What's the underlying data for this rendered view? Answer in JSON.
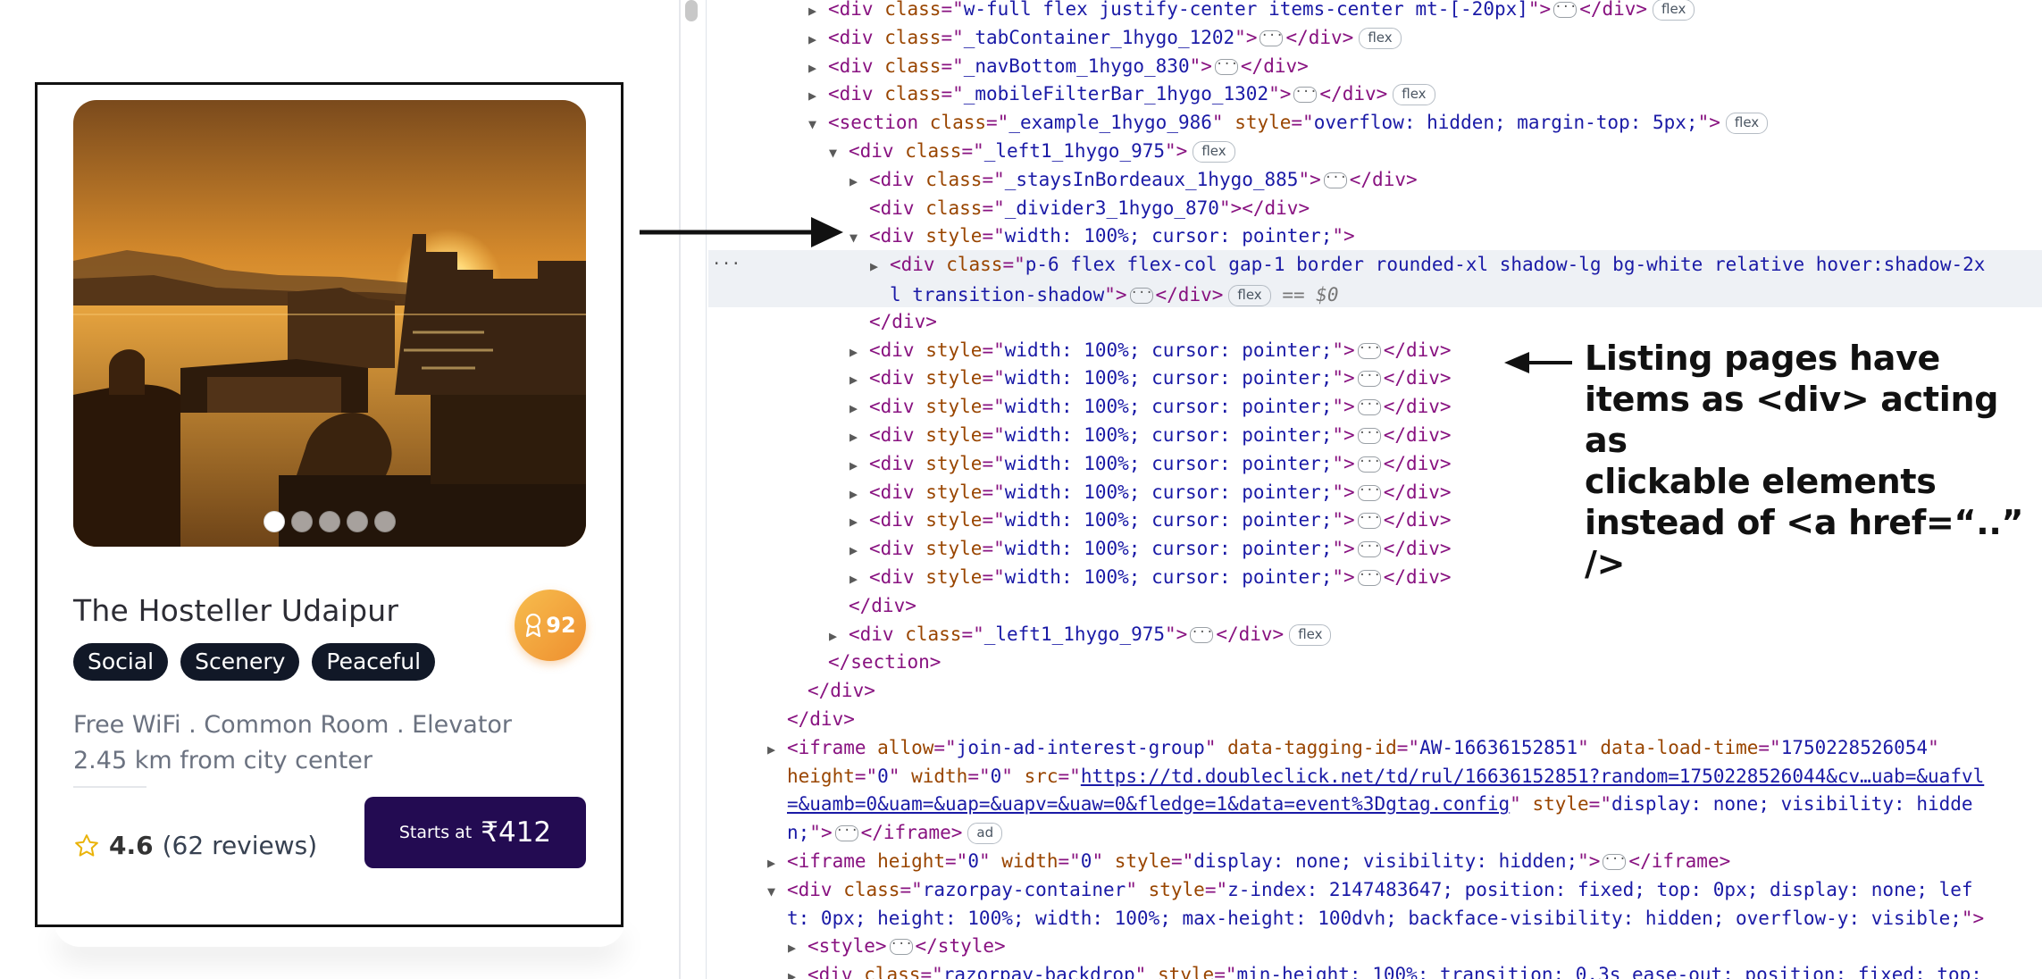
{
  "card": {
    "hotel_name": "The Hosteller Udaipur",
    "score": "92",
    "tags": [
      "Social",
      "Scenery",
      "Peaceful"
    ],
    "amenities": "Free WiFi . Common Room . Elevator",
    "distance": "2.45 km from city center",
    "rating_value": "4.6",
    "rating_reviews": "(62 reviews)",
    "cta_prefix": "Starts at",
    "cta_price": "₹412",
    "carousel": {
      "total": 5,
      "active": 1
    },
    "colors": {
      "cta_bg": "#230b52",
      "badge": "#f0a43c",
      "tag_bg": "#111827"
    }
  },
  "devtools": {
    "rows": [
      {
        "indent": 5,
        "arrow": "right",
        "parts": [
          [
            "t",
            "<div "
          ],
          [
            "a",
            "class"
          ],
          [
            "t",
            "=\""
          ],
          [
            "v",
            "w-full flex justify-center items-center mt-[-20px]"
          ],
          [
            "t",
            "\">"
          ],
          [
            "e",
            ""
          ],
          [
            "t",
            "</div>"
          ],
          [
            "p",
            "flex"
          ]
        ]
      },
      {
        "indent": 5,
        "arrow": "right",
        "parts": [
          [
            "t",
            "<div "
          ],
          [
            "a",
            "class"
          ],
          [
            "t",
            "=\""
          ],
          [
            "v",
            "_tabContainer_1hygo_1202"
          ],
          [
            "t",
            "\">"
          ],
          [
            "e",
            ""
          ],
          [
            "t",
            "</div>"
          ],
          [
            "p",
            "flex"
          ]
        ]
      },
      {
        "indent": 5,
        "arrow": "right",
        "parts": [
          [
            "t",
            "<div "
          ],
          [
            "a",
            "class"
          ],
          [
            "t",
            "=\""
          ],
          [
            "v",
            "_navBottom_1hygo_830"
          ],
          [
            "t",
            "\">"
          ],
          [
            "e",
            ""
          ],
          [
            "t",
            "</div>"
          ]
        ]
      },
      {
        "indent": 5,
        "arrow": "right",
        "parts": [
          [
            "t",
            "<div "
          ],
          [
            "a",
            "class"
          ],
          [
            "t",
            "=\""
          ],
          [
            "v",
            "_mobileFilterBar_1hygo_1302"
          ],
          [
            "t",
            "\">"
          ],
          [
            "e",
            ""
          ],
          [
            "t",
            "</div>"
          ],
          [
            "p",
            "flex"
          ]
        ]
      },
      {
        "indent": 5,
        "arrow": "down",
        "parts": [
          [
            "t",
            "<section "
          ],
          [
            "a",
            "class"
          ],
          [
            "t",
            "=\""
          ],
          [
            "v",
            "_example_1hygo_986"
          ],
          [
            "t",
            "\" "
          ],
          [
            "a",
            "style"
          ],
          [
            "t",
            "=\""
          ],
          [
            "v",
            "overflow: hidden; margin-top: 5px;"
          ],
          [
            "t",
            "\">"
          ],
          [
            "p",
            "flex"
          ]
        ]
      },
      {
        "indent": 6,
        "arrow": "down",
        "parts": [
          [
            "t",
            "<div "
          ],
          [
            "a",
            "class"
          ],
          [
            "t",
            "=\""
          ],
          [
            "v",
            "_left1_1hygo_975"
          ],
          [
            "t",
            "\">"
          ],
          [
            "p",
            "flex"
          ]
        ]
      },
      {
        "indent": 7,
        "arrow": "right",
        "parts": [
          [
            "t",
            "<div "
          ],
          [
            "a",
            "class"
          ],
          [
            "t",
            "=\""
          ],
          [
            "v",
            "_staysInBordeaux_1hygo_885"
          ],
          [
            "t",
            "\">"
          ],
          [
            "e",
            ""
          ],
          [
            "t",
            "</div>"
          ]
        ]
      },
      {
        "indent": 7,
        "arrow": "none",
        "parts": [
          [
            "t",
            "<div "
          ],
          [
            "a",
            "class"
          ],
          [
            "t",
            "=\""
          ],
          [
            "v",
            "_divider3_1hygo_870"
          ],
          [
            "t",
            "\"></div>"
          ]
        ]
      },
      {
        "indent": 7,
        "arrow": "down",
        "parts": [
          [
            "t",
            "<div "
          ],
          [
            "a",
            "style"
          ],
          [
            "t",
            "=\""
          ],
          [
            "v",
            "width: 100%; cursor: pointer;"
          ],
          [
            "t",
            "\">"
          ]
        ]
      },
      {
        "indent": 8,
        "arrow": "right",
        "selected": true,
        "parts": [
          [
            "t",
            "<div "
          ],
          [
            "a",
            "class"
          ],
          [
            "t",
            "=\""
          ],
          [
            "v",
            "p-6 flex flex-col gap-1 border rounded-xl shadow-lg bg-white relative hover:shadow-2x"
          ]
        ],
        "parts2": [
          [
            "v",
            "l transition-shadow"
          ],
          [
            "t",
            "\">"
          ],
          [
            "e",
            ""
          ],
          [
            "t",
            "</div>"
          ],
          [
            "p",
            "flex"
          ],
          [
            "q",
            " == $0"
          ]
        ]
      },
      {
        "indent": 7,
        "arrow": "none",
        "parts": [
          [
            "t",
            "</div>"
          ]
        ]
      },
      {
        "indent": 7,
        "arrow": "right",
        "parts": [
          [
            "t",
            "<div "
          ],
          [
            "a",
            "style"
          ],
          [
            "t",
            "=\""
          ],
          [
            "v",
            "width: 100%; cursor: pointer;"
          ],
          [
            "t",
            "\">"
          ],
          [
            "e",
            ""
          ],
          [
            "t",
            "</div>"
          ]
        ]
      },
      {
        "indent": 7,
        "arrow": "right",
        "parts": [
          [
            "t",
            "<div "
          ],
          [
            "a",
            "style"
          ],
          [
            "t",
            "=\""
          ],
          [
            "v",
            "width: 100%; cursor: pointer;"
          ],
          [
            "t",
            "\">"
          ],
          [
            "e",
            ""
          ],
          [
            "t",
            "</div>"
          ]
        ]
      },
      {
        "indent": 7,
        "arrow": "right",
        "parts": [
          [
            "t",
            "<div "
          ],
          [
            "a",
            "style"
          ],
          [
            "t",
            "=\""
          ],
          [
            "v",
            "width: 100%; cursor: pointer;"
          ],
          [
            "t",
            "\">"
          ],
          [
            "e",
            ""
          ],
          [
            "t",
            "</div>"
          ]
        ]
      },
      {
        "indent": 7,
        "arrow": "right",
        "parts": [
          [
            "t",
            "<div "
          ],
          [
            "a",
            "style"
          ],
          [
            "t",
            "=\""
          ],
          [
            "v",
            "width: 100%; cursor: pointer;"
          ],
          [
            "t",
            "\">"
          ],
          [
            "e",
            ""
          ],
          [
            "t",
            "</div>"
          ]
        ]
      },
      {
        "indent": 7,
        "arrow": "right",
        "parts": [
          [
            "t",
            "<div "
          ],
          [
            "a",
            "style"
          ],
          [
            "t",
            "=\""
          ],
          [
            "v",
            "width: 100%; cursor: pointer;"
          ],
          [
            "t",
            "\">"
          ],
          [
            "e",
            ""
          ],
          [
            "t",
            "</div>"
          ]
        ]
      },
      {
        "indent": 7,
        "arrow": "right",
        "parts": [
          [
            "t",
            "<div "
          ],
          [
            "a",
            "style"
          ],
          [
            "t",
            "=\""
          ],
          [
            "v",
            "width: 100%; cursor: pointer;"
          ],
          [
            "t",
            "\">"
          ],
          [
            "e",
            ""
          ],
          [
            "t",
            "</div>"
          ]
        ]
      },
      {
        "indent": 7,
        "arrow": "right",
        "parts": [
          [
            "t",
            "<div "
          ],
          [
            "a",
            "style"
          ],
          [
            "t",
            "=\""
          ],
          [
            "v",
            "width: 100%; cursor: pointer;"
          ],
          [
            "t",
            "\">"
          ],
          [
            "e",
            ""
          ],
          [
            "t",
            "</div>"
          ]
        ]
      },
      {
        "indent": 7,
        "arrow": "right",
        "parts": [
          [
            "t",
            "<div "
          ],
          [
            "a",
            "style"
          ],
          [
            "t",
            "=\""
          ],
          [
            "v",
            "width: 100%; cursor: pointer;"
          ],
          [
            "t",
            "\">"
          ],
          [
            "e",
            ""
          ],
          [
            "t",
            "</div>"
          ]
        ]
      },
      {
        "indent": 7,
        "arrow": "right",
        "parts": [
          [
            "t",
            "<div "
          ],
          [
            "a",
            "style"
          ],
          [
            "t",
            "=\""
          ],
          [
            "v",
            "width: 100%; cursor: pointer;"
          ],
          [
            "t",
            "\">"
          ],
          [
            "e",
            ""
          ],
          [
            "t",
            "</div>"
          ]
        ]
      },
      {
        "indent": 6,
        "arrow": "none",
        "parts": [
          [
            "t",
            "</div>"
          ]
        ]
      },
      {
        "indent": 6,
        "arrow": "right",
        "parts": [
          [
            "t",
            "<div "
          ],
          [
            "a",
            "class"
          ],
          [
            "t",
            "=\""
          ],
          [
            "v",
            "_left1_1hygo_975"
          ],
          [
            "t",
            "\">"
          ],
          [
            "e",
            ""
          ],
          [
            "t",
            "</div>"
          ],
          [
            "p",
            "flex"
          ]
        ]
      },
      {
        "indent": 5,
        "arrow": "none",
        "parts": [
          [
            "t",
            "</section>"
          ]
        ]
      },
      {
        "indent": 4,
        "arrow": "none",
        "parts": [
          [
            "t",
            "</div>"
          ]
        ]
      },
      {
        "indent": 3,
        "arrow": "none",
        "parts": [
          [
            "t",
            "</div>"
          ]
        ]
      },
      {
        "indent": 3,
        "arrow": "right",
        "parts": [
          [
            "t",
            "<iframe "
          ],
          [
            "a",
            "allow"
          ],
          [
            "t",
            "=\""
          ],
          [
            "v",
            "join-ad-interest-group"
          ],
          [
            "t",
            "\" "
          ],
          [
            "a",
            "data-tagging-id"
          ],
          [
            "t",
            "=\""
          ],
          [
            "v",
            "AW-16636152851"
          ],
          [
            "t",
            "\" "
          ],
          [
            "a",
            "data-load-time"
          ],
          [
            "t",
            "=\""
          ],
          [
            "v",
            "1750228526054"
          ],
          [
            "t",
            "\""
          ]
        ]
      },
      {
        "indent": 3,
        "arrow": "none",
        "parts": [
          [
            "a",
            "height"
          ],
          [
            "t",
            "=\""
          ],
          [
            "v",
            "0"
          ],
          [
            "t",
            "\" "
          ],
          [
            "a",
            "width"
          ],
          [
            "t",
            "=\""
          ],
          [
            "v",
            "0"
          ],
          [
            "t",
            "\" "
          ],
          [
            "a",
            "src"
          ],
          [
            "t",
            "=\""
          ],
          [
            "l",
            "https://td.doubleclick.net/td/rul/16636152851?random=1750228526044&cv…uab=&uafvl"
          ]
        ]
      },
      {
        "indent": 3,
        "arrow": "none",
        "parts": [
          [
            "l",
            "=&uamb=0&uam=&uap=&uapv=&uaw=0&fledge=1&data=event%3Dgtag.config"
          ],
          [
            "t",
            "\" "
          ],
          [
            "a",
            "style"
          ],
          [
            "t",
            "=\""
          ],
          [
            "v",
            "display: none; visibility: hidde"
          ]
        ]
      },
      {
        "indent": 3,
        "arrow": "none",
        "parts": [
          [
            "v",
            "n;"
          ],
          [
            "t",
            "\">"
          ],
          [
            "e",
            ""
          ],
          [
            "t",
            "</iframe>"
          ],
          [
            "p",
            "ad"
          ]
        ]
      },
      {
        "indent": 3,
        "arrow": "right",
        "parts": [
          [
            "t",
            "<iframe "
          ],
          [
            "a",
            "height"
          ],
          [
            "t",
            "=\""
          ],
          [
            "v",
            "0"
          ],
          [
            "t",
            "\" "
          ],
          [
            "a",
            "width"
          ],
          [
            "t",
            "=\""
          ],
          [
            "v",
            "0"
          ],
          [
            "t",
            "\" "
          ],
          [
            "a",
            "style"
          ],
          [
            "t",
            "=\""
          ],
          [
            "v",
            "display: none; visibility: hidden;"
          ],
          [
            "t",
            "\">"
          ],
          [
            "e",
            ""
          ],
          [
            "t",
            "</iframe>"
          ]
        ]
      },
      {
        "indent": 3,
        "arrow": "down",
        "parts": [
          [
            "t",
            "<div "
          ],
          [
            "a",
            "class"
          ],
          [
            "t",
            "=\""
          ],
          [
            "v",
            "razorpay-container"
          ],
          [
            "t",
            "\" "
          ],
          [
            "a",
            "style"
          ],
          [
            "t",
            "=\""
          ],
          [
            "v",
            "z-index: 2147483647; position: fixed; top: 0px; display: none; lef"
          ]
        ]
      },
      {
        "indent": 3,
        "arrow": "none",
        "parts": [
          [
            "v",
            "t: 0px; height: 100%; width: 100%; max-height: 100dvh; backface-visibility: hidden; overflow-y: visible;"
          ],
          [
            "t",
            "\">"
          ]
        ]
      },
      {
        "indent": 4,
        "arrow": "right",
        "parts": [
          [
            "t",
            "<style>"
          ],
          [
            "e",
            ""
          ],
          [
            "t",
            "</style>"
          ]
        ]
      },
      {
        "indent": 4,
        "arrow": "right",
        "parts": [
          [
            "t",
            "<div "
          ],
          [
            "a",
            "class"
          ],
          [
            "t",
            "=\""
          ],
          [
            "v",
            "razorpay-backdrop"
          ],
          [
            "t",
            "\" "
          ],
          [
            "a",
            "style"
          ],
          [
            "t",
            "=\""
          ],
          [
            "v",
            "min-height: 100%; transition: 0.3s ease-out; position: fixed; top:"
          ]
        ]
      }
    ]
  },
  "annotation": {
    "text_lines": [
      "Listing pages have",
      "items as <div> acting as",
      "clickable elements",
      "instead of <a href=“..” />"
    ]
  }
}
